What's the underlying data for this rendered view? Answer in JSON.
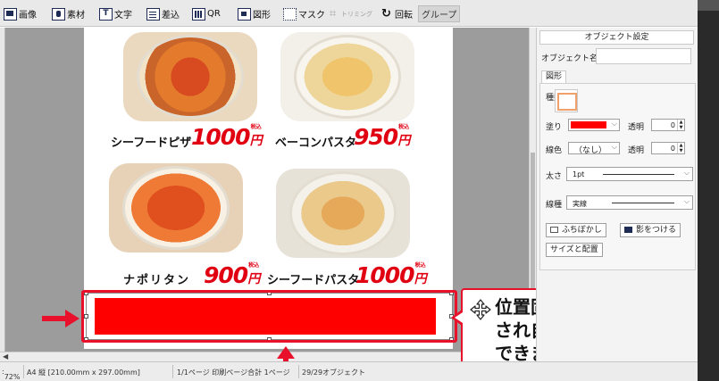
{
  "toolbar": {
    "image": "画像",
    "material": "素材",
    "text": "文字",
    "insert": "差込",
    "qr": "QR",
    "shape": "図形",
    "mask": "マスク",
    "trimming": "トリミング",
    "rotate": "回転",
    "group": "グループ"
  },
  "menu_items": [
    {
      "name": "シーフードピザ",
      "price": "1000",
      "yen": "円",
      "tax": "税込"
    },
    {
      "name": "ベーコンパスタ",
      "price": "950",
      "yen": "円",
      "tax": "税込"
    },
    {
      "name": "ナポリタン",
      "price": "900",
      "yen": "円",
      "tax": "税込"
    },
    {
      "name": "シーフードパスタ",
      "price": "1000",
      "yen": "円",
      "tax": "税込"
    }
  ],
  "callout": {
    "text": "位置固定が解除\nされ自由に移動\nできます"
  },
  "status": {
    "zoom": "72%",
    "paper": "A4 縦 [210.00mm x 297.00mm]",
    "pages": "1/1ページ 印刷ページ合計 1ページ",
    "objects": "29/29オブジェクト"
  },
  "panel": {
    "title": "オブジェクト設定",
    "object_name_label": "オブジェクト名",
    "object_name_value": "",
    "tab": "図形",
    "type_label": "種類",
    "fill_label": "塗り",
    "fill_color": "#ff0000",
    "transparency_label": "透明",
    "fill_transparency": "0",
    "line_color_label": "線色",
    "line_color_value": "（なし）",
    "line_transparency": "0",
    "thickness_label": "太さ",
    "thickness_value": "1pt",
    "line_type_label": "線種",
    "line_type_value": "実線",
    "blur_button": "ふちぼかし",
    "shadow_button": "影をつける",
    "size_button": "サイズと配置"
  },
  "colors": {
    "accent_red": "#e8102a",
    "price_red": "#e00012",
    "shape_fill": "#ff0000"
  }
}
